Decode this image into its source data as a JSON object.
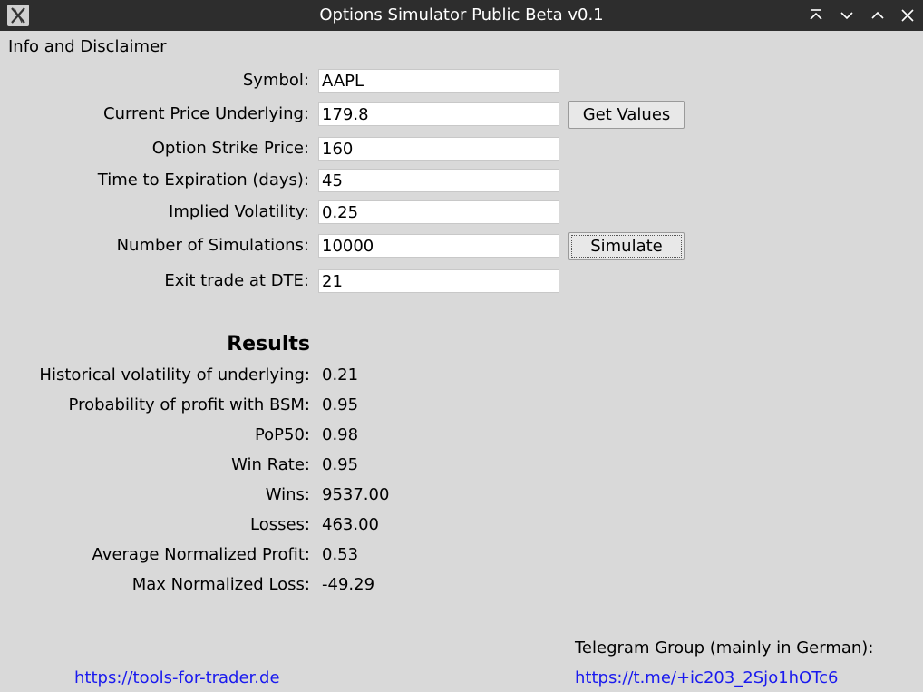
{
  "window": {
    "title": "Options Simulator Public Beta v0.1"
  },
  "menu": {
    "items": [
      "Info and Disclaimer"
    ]
  },
  "form": {
    "symbol_label": "Symbol:",
    "symbol_value": "AAPL",
    "price_label": "Current Price Underlying:",
    "price_value": "179.8",
    "strike_label": "Option Strike Price:",
    "strike_value": "160",
    "expiration_label": "Time to Expiration (days):",
    "expiration_value": "45",
    "iv_label": "Implied Volatility:",
    "iv_value": "0.25",
    "sims_label": "Number of Simulations:",
    "sims_value": "10000",
    "exit_label": "Exit trade at DTE:",
    "exit_value": "21",
    "get_values_label": "Get Values",
    "simulate_label": "Simulate"
  },
  "results": {
    "title": "Results",
    "rows": [
      {
        "label": "Historical volatility of underlying:",
        "value": "0.21"
      },
      {
        "label": "Probability of profit with BSM:",
        "value": "0.95"
      },
      {
        "label": "PoP50:",
        "value": "0.98"
      },
      {
        "label": "Win Rate:",
        "value": "0.95"
      },
      {
        "label": "Wins:",
        "value": "9537.00"
      },
      {
        "label": "Losses:",
        "value": "463.00"
      },
      {
        "label": "Average Normalized Profit:",
        "value": "0.53"
      },
      {
        "label": "Max Normalized Loss:",
        "value": "-49.29"
      }
    ]
  },
  "footer": {
    "website_link": "https://tools-for-trader.de",
    "telegram_note": "Telegram Group (mainly in German):",
    "telegram_link": "https://t.me/+ic203_2Sjo1hOTc6"
  },
  "colors": {
    "titlebar": "#2d2d2d",
    "background": "#d9d9d9",
    "link": "#1a1aee"
  },
  "icons": {
    "app": "app-x-icon",
    "window_controls": [
      "keep-above-icon",
      "minimize-icon",
      "maximize-icon",
      "close-icon"
    ]
  }
}
